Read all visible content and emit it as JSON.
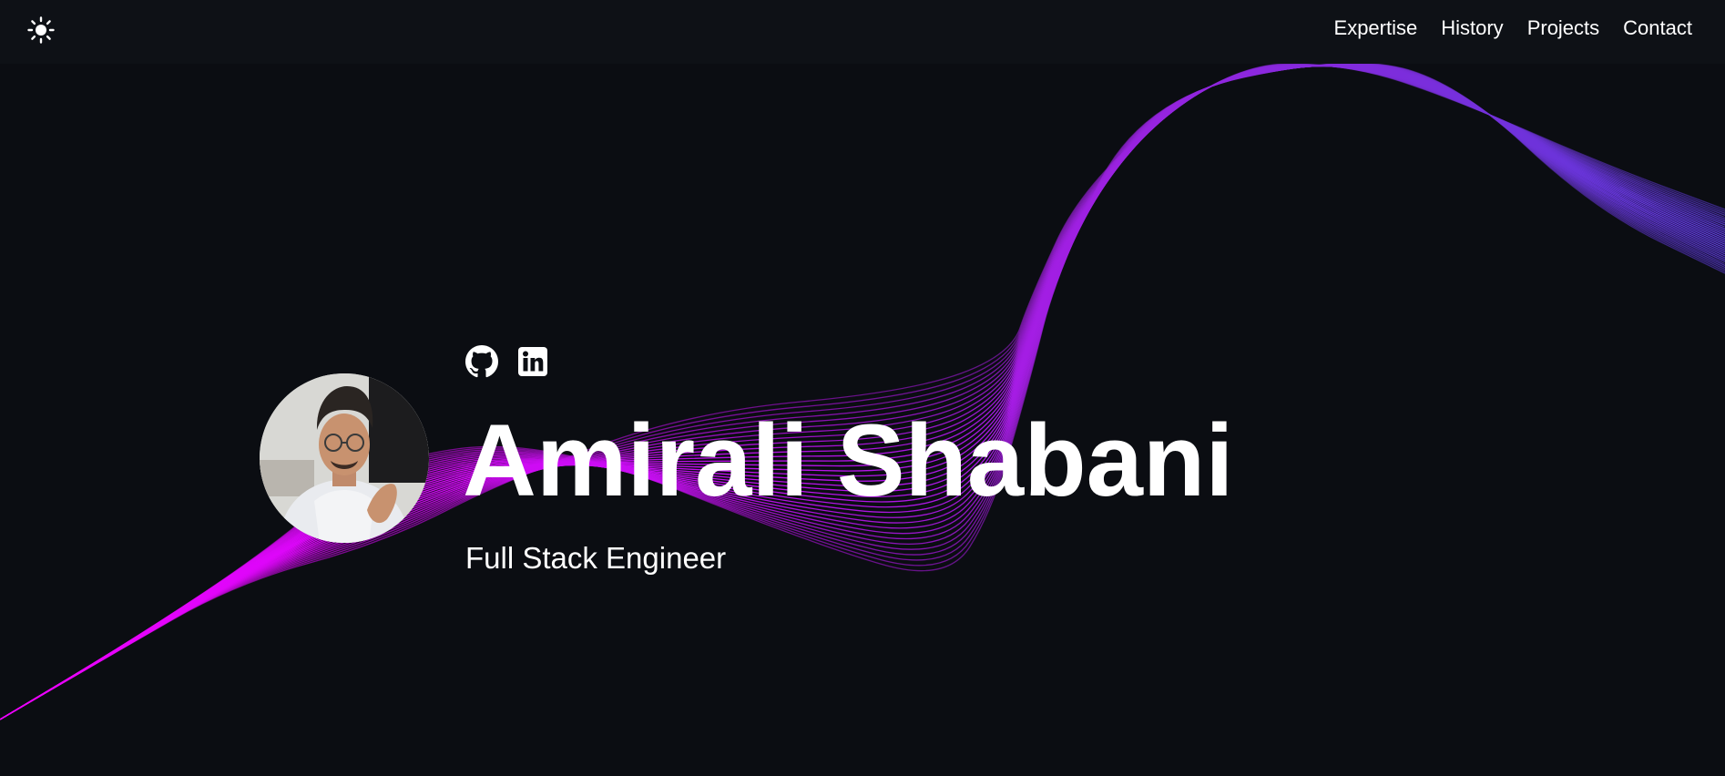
{
  "nav": {
    "theme_icon": "sun-icon",
    "links": [
      {
        "label": "Expertise"
      },
      {
        "label": "History"
      },
      {
        "label": "Projects"
      },
      {
        "label": "Contact"
      }
    ]
  },
  "hero": {
    "name": "Amirali Shabani",
    "role": "Full Stack Engineer",
    "avatar_icon": "profile-photo",
    "socials": [
      {
        "icon": "github-icon"
      },
      {
        "icon": "linkedin-icon"
      }
    ]
  },
  "colors": {
    "background": "#0b0d12",
    "navbar": "#0e1116",
    "text": "#ffffff",
    "wave_start": "#ee00ff",
    "wave_mid": "#a020e8",
    "wave_end": "#5a3ad8"
  }
}
